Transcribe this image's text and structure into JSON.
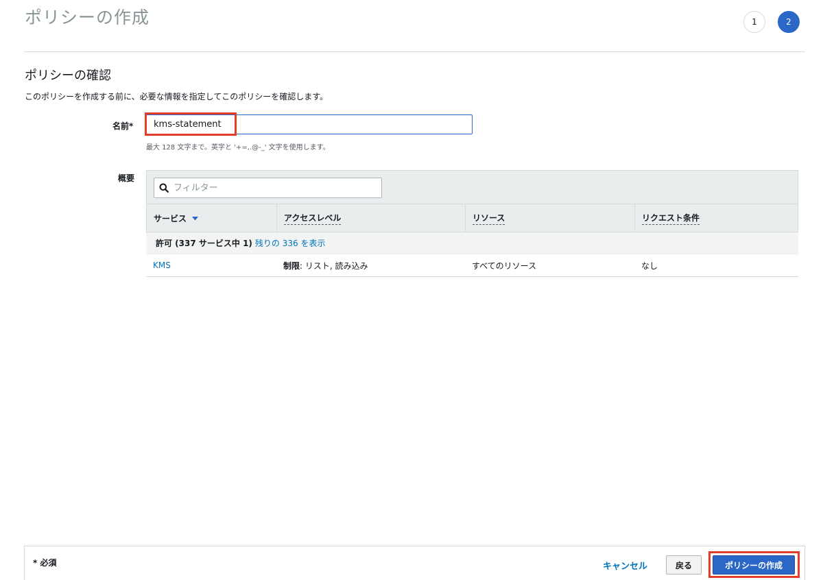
{
  "header": {
    "title": "ポリシーの作成",
    "steps": [
      "1",
      "2"
    ]
  },
  "review": {
    "title": "ポリシーの確認",
    "description": "このポリシーを作成する前に、必要な情報を指定してこのポリシーを確認します。"
  },
  "form": {
    "name_label": "名前*",
    "name_value": "kms-statement",
    "name_hint": "最大 128 文字まで。英字と '+=,.@-_' 文字を使用します。",
    "summary_label": "概要"
  },
  "summary": {
    "filter_placeholder": "フィルター",
    "columns": [
      "サービス",
      "アクセスレベル",
      "リソース",
      "リクエスト条件"
    ],
    "group": {
      "label": "許可 (337 サービス中 1)",
      "link": "残りの 336 を表示"
    },
    "rows": [
      {
        "service": "KMS",
        "access_level_prefix": "制限",
        "access_level": ": リスト, 読み込み",
        "resource": "すべてのリソース",
        "condition": "なし"
      }
    ]
  },
  "footer": {
    "required_note": "* 必須",
    "cancel_label": "キャンセル",
    "back_label": "戻る",
    "create_label": "ポリシーの作成"
  },
  "colors": {
    "primary": "#2a67c6",
    "link": "#0073bb",
    "highlight": "#e23d28"
  }
}
